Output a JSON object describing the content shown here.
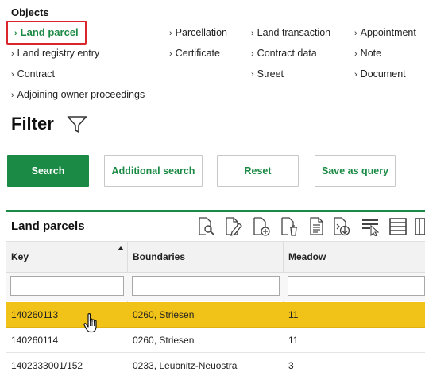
{
  "objects": {
    "title": "Objects",
    "active_item": "Land parcel",
    "items": [
      "Parcellation",
      "Land transaction",
      "Appointment",
      "Land registry entry",
      "Certificate",
      "Contract data",
      "Note",
      "Contract",
      "Street",
      "Document",
      "Adjoining owner proceedings"
    ]
  },
  "filter": {
    "title": "Filter",
    "icon": "funnel-icon"
  },
  "buttons": {
    "search": "Search",
    "additional_search": "Additional search",
    "reset": "Reset",
    "save_as_query": "Save as query"
  },
  "grid": {
    "title": "Land parcels",
    "accent_color": "#1b8a44",
    "selected_row_color": "#f1c318",
    "toolbar_icons": [
      "view-document-icon",
      "edit-document-icon",
      "add-document-icon",
      "delete-document-icon",
      "text-document-icon",
      "export-document-icon",
      "select-rows-icon",
      "list-view-icon",
      "columns-icon"
    ],
    "columns": [
      "Key",
      "Boundaries",
      "Meadow"
    ],
    "sort": {
      "column": "Key",
      "direction": "ascending"
    },
    "filters": [
      "",
      "",
      ""
    ],
    "rows": [
      [
        "140260113",
        "0260, Striesen",
        "11"
      ],
      [
        "140260114",
        "0260, Striesen",
        "11"
      ],
      [
        "1402333001/152",
        "0233, Leubnitz-Neuostra",
        "3"
      ]
    ],
    "selected_row": 0
  }
}
